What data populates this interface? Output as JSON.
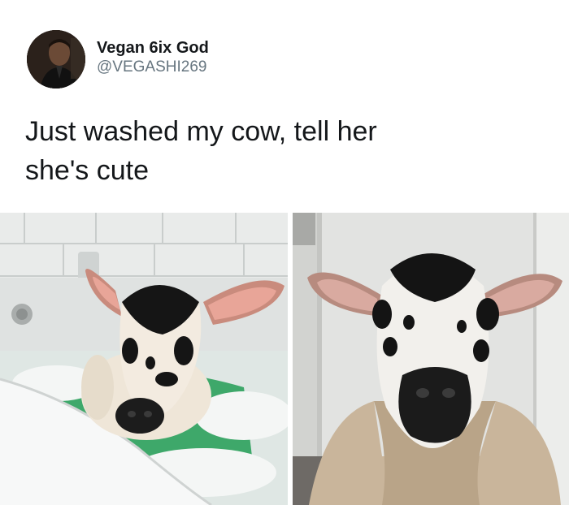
{
  "tweet": {
    "display_name": "Vegan 6ix God",
    "handle": "@VEGASHI269",
    "text_line1": "Just washed my cow, tell her",
    "text_line2": "she's cute"
  },
  "icons": {
    "avatar": "profile-photo"
  },
  "colors": {
    "name": "#14171a",
    "handle": "#66757f",
    "background": "#ffffff"
  }
}
